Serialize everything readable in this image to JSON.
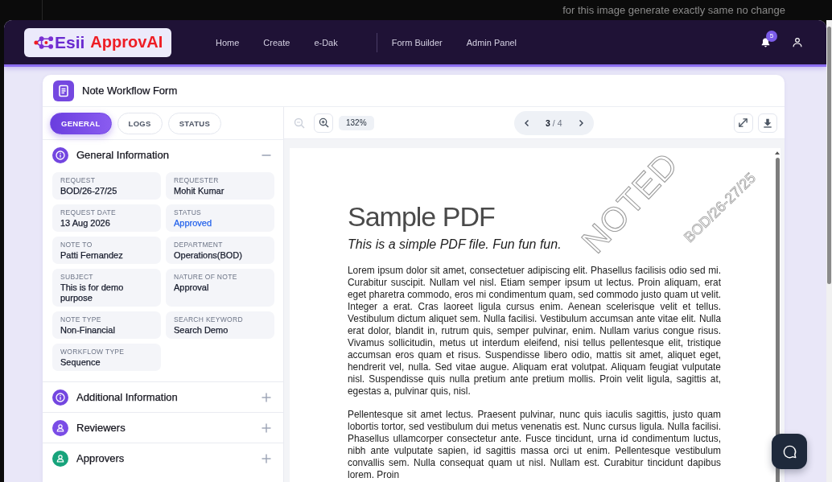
{
  "backdrop": {
    "text": "for this image generate exactly same no change"
  },
  "header": {
    "logo": {
      "mark": "Esii",
      "name": "ApprovAI"
    },
    "nav_groups": [
      [
        "Home",
        "Create",
        "e-Dak"
      ],
      [
        "Form Builder",
        "Admin Panel"
      ]
    ],
    "notifications": {
      "count": "5"
    }
  },
  "form": {
    "title": "Note Workflow Form",
    "tabs": [
      {
        "label": "GENERAL",
        "selected": true
      },
      {
        "label": "LOGS",
        "selected": false
      },
      {
        "label": "STATUS",
        "selected": false
      }
    ],
    "sections": [
      {
        "title": "General Information",
        "kind": "info",
        "color": "#7346e0",
        "expanded": true,
        "fields": [
          {
            "label": "REQUEST",
            "value": "BOD/26-27/25",
            "kind": "text"
          },
          {
            "label": "REQUESTER",
            "value": "Mohit Kumar",
            "kind": "text"
          },
          {
            "label": "REQUEST DATE",
            "value": "13 Aug 2026",
            "kind": "text"
          },
          {
            "label": "STATUS",
            "value": "Approved",
            "kind": "status"
          },
          {
            "label": "NOTE TO",
            "value": "Patti Fernandez",
            "kind": "text"
          },
          {
            "label": "DEPARTMENT",
            "value": "Operations(BOD)",
            "kind": "text"
          },
          {
            "label": "SUBJECT",
            "value": "This is for demo purpose",
            "kind": "text"
          },
          {
            "label": "NATURE OF NOTE",
            "value": "Approval",
            "kind": "text"
          },
          {
            "label": "NOTE TYPE",
            "value": "Non-Financial",
            "kind": "text"
          },
          {
            "label": "SEARCH KEYWORD",
            "value": "Search Demo",
            "kind": "text"
          },
          {
            "label": "WORKFLOW TYPE",
            "value": "Sequence",
            "kind": "text"
          }
        ]
      },
      {
        "title": "Additional Information",
        "kind": "info",
        "color": "#7346e0",
        "expanded": false
      },
      {
        "title": "Reviewers",
        "kind": "person",
        "color": "#7a4ce6",
        "expanded": false
      },
      {
        "title": "Approvers",
        "kind": "person",
        "color": "#17a37b",
        "expanded": false
      }
    ]
  },
  "viewer": {
    "zoom_out": {
      "disabled": true
    },
    "zoom_in": {
      "disabled": false
    },
    "zoom": "132%",
    "page": "3",
    "page_total": "/ 4",
    "document": {
      "title": "Sample PDF",
      "subtitle": "This is a simple PDF file. Fun fun fun.",
      "paragraphs": [
        "Lorem ipsum dolor sit amet, consectetuer adipiscing elit. Phasellus facilisis odio sed mi. Curabitur suscipit. Nullam vel nisl. Etiam semper ipsum ut lectus. Proin aliquam, erat eget pharetra commodo, eros mi condimentum quam, sed commodo justo quam ut velit. Integer a erat. Cras laoreet ligula cursus enim. Aenean scelerisque velit et tellus. Vestibulum dictum aliquet sem. Nulla facilisi. Vestibulum accumsan ante vitae elit. Nulla erat dolor, blandit in, rutrum quis, semper pulvinar, enim. Nullam varius congue risus. Vivamus sollicitudin, metus ut interdum eleifend, nisi tellus pellentesque elit, tristique accumsan eros quam et risus. Suspendisse libero odio, mattis sit amet, aliquet eget, hendrerit vel, nulla. Sed vitae augue. Aliquam erat volutpat. Aliquam feugiat vulputate nisl. Suspendisse quis nulla pretium ante pretium mollis. Proin velit ligula, sagittis at, egestas a, pulvinar quis, nisl.",
        "Pellentesque sit amet lectus. Praesent pulvinar, nunc quis iaculis sagittis, justo quam lobortis tortor, sed vestibulum dui metus venenatis est. Nunc cursus ligula. Nulla facilisi. Phasellus ullamcorper consectetur ante. Fusce tincidunt, urna id condimentum luctus, nibh ante vulputate sapien, id sagittis massa orci ut enim. Pellentesque vestibulum convallis sem. Nulla consequat quam ut nisl. Nullam est. Curabitur tincidunt dapibus lorem. Proin"
      ],
      "stamp": {
        "text": "NOTED",
        "reference": "BOD/26-27/25"
      }
    }
  }
}
